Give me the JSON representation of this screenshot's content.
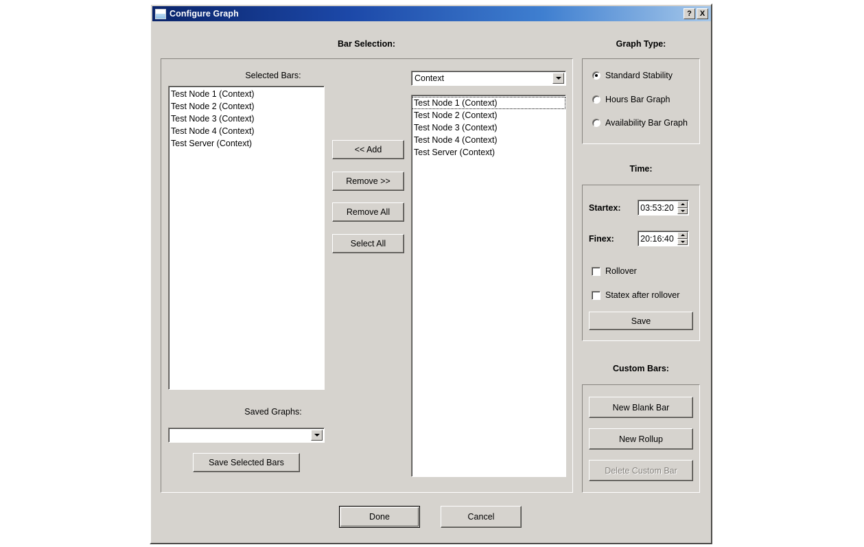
{
  "window": {
    "title": "Configure Graph",
    "icon": "document-icon",
    "help_button": "?",
    "close_button": "X"
  },
  "bar_selection": {
    "title": "Bar Selection:",
    "selected_bars_label": "Selected Bars:",
    "selected_bars": [
      "Test Node 1 (Context)",
      "Test Node 2 (Context)",
      "Test Node 3 (Context)",
      "Test Node 4 (Context)",
      "Test Server (Context)"
    ],
    "available_filter": {
      "value": "Context",
      "options": [
        "Context"
      ]
    },
    "available_bars": [
      "Test Node 1 (Context)",
      "Test Node 2 (Context)",
      "Test Node 3 (Context)",
      "Test Node 4 (Context)",
      "Test Server (Context)"
    ],
    "available_focused_index": 0,
    "transfer_buttons": [
      {
        "label": "<< Add"
      },
      {
        "label": "Remove >>"
      },
      {
        "label": "Remove All"
      },
      {
        "label": "Select All"
      }
    ],
    "saved_graphs_label": "Saved Graphs:",
    "saved_graphs": {
      "value": "",
      "options": []
    },
    "save_selected_bars_label": "Save Selected Bars"
  },
  "graph_type": {
    "title": "Graph Type:",
    "options": [
      {
        "label": "Standard Stability",
        "selected": true
      },
      {
        "label": "Hours Bar Graph",
        "selected": false
      },
      {
        "label": "Availability Bar Graph",
        "selected": false
      }
    ]
  },
  "time": {
    "title": "Time:",
    "startex_label": "Startex:",
    "startex_value": "03:53:20",
    "finex_label": "Finex:",
    "finex_value": "20:16:40",
    "rollover_label": "Rollover",
    "rollover_checked": false,
    "statex_label": "Statex after rollover",
    "statex_checked": false,
    "save_label": "Save"
  },
  "custom_bars": {
    "title": "Custom Bars:",
    "new_blank_bar_label": "New Blank Bar",
    "new_rollup_label": "New Rollup",
    "delete_custom_bar_label": "Delete Custom Bar",
    "delete_custom_bar_enabled": false
  },
  "footer": {
    "done_label": "Done",
    "cancel_label": "Cancel"
  },
  "colors": {
    "dialog_face": "#d6d3ce",
    "title_gradient_start": "#0a246a",
    "title_gradient_end": "#a6c8ea",
    "field_bg": "#ffffff",
    "text": "#000000",
    "disabled_text": "#86837e"
  }
}
